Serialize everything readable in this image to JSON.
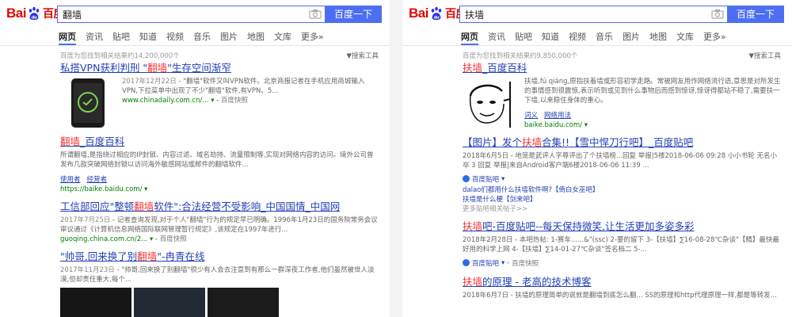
{
  "left": {
    "logo": {
      "text": "Bai",
      "zh": "百度"
    },
    "search": {
      "value": "翻墙",
      "button": "百度一下"
    },
    "tabs": [
      "网页",
      "资讯",
      "贴吧",
      "知道",
      "视频",
      "音乐",
      "图片",
      "地图",
      "文库",
      "更多»"
    ],
    "meta": {
      "count": "百度为您找到相关结果约14,200,000个",
      "tool": "搜索工具"
    },
    "results": [
      {
        "title_pre": "私搭VPN获利判刑 \"",
        "title_hl": "翻墙",
        "title_post": "\"生存空间渐窄",
        "date": "2017年12月22日",
        "abstract": " - \"翻墙\"软件又叫VPN软件。北京商报记者在手机应用商城输入VPN,下拉菜单中出现了不少\"翻墙\"软件,有VPN、5...",
        "url": "www.chinadaily.com.cn/...",
        "snap": "百度快照"
      },
      {
        "title_hl": "翻墙",
        "title_post": "_百度百科",
        "abstract": "所谓翻墙,是指绕过相应的IP封锁、内容过滤、域名劫持、流量限制等,实现对网络内容的访问。境外公司曾发布几款突破网络封锁以访问海外敏感网站或邮件的翻墙软件...",
        "subs": [
          "使用者",
          "经营者"
        ],
        "url": "https://baike.baidu.com/"
      },
      {
        "title_pre": "工信部回应\"整顿",
        "title_hl": "翻墙",
        "title_post": "软件\":合法经营不受影响_中国国情_中国网",
        "date": "2017年7月25日",
        "abstract": " - 记者查询发现,对于个人\"翻墙\"行为的规定早已明确。1996年1月23日的国务院常务会议审议通过《计算机信息网络国际联网管理暂行规定》,该规定在1997年进行...",
        "url": "guoqing.china.com.cn/2...",
        "snap": "百度快照"
      },
      {
        "title_pre": "\"帅哥,回来换了别",
        "title_hl": "翻墙",
        "title_post": "\"-冉青在线",
        "date": "2017年11月23日",
        "abstract": " - \"帅哥,回来换了别翻墙\"很少有人会去注意到有那么一群深夜工作者,他们虽然被世人淡漠,但却责任重大,每个..."
      }
    ]
  },
  "right": {
    "logo": {
      "text": "Bai",
      "zh": "百度"
    },
    "search": {
      "value": "扶墙",
      "button": "百度一下"
    },
    "tabs": [
      "网页",
      "资讯",
      "贴吧",
      "知道",
      "视频",
      "音乐",
      "图片",
      "地图",
      "文库",
      "更多»"
    ],
    "meta": {
      "count": "百度为您找到相关结果约9,850,000个",
      "tool": "搜索工具"
    },
    "results": [
      {
        "title_hl": "扶墙",
        "title_post": "_百度百科",
        "abstract": "扶墙,fú qiáng,原指扶着墙或形容初学走路。常被网友用作网络流行语,意思是对所发生的事情感到很震惊,表示听到或见到什么事物后而感到惊讶,惊讶得都站不稳了,需要扶一下墙,以来稳住身体的重心。",
        "subs": [
          "词义",
          "网络用法"
        ],
        "url": "baike.baidu.com/"
      },
      {
        "title_pre": "【图片】发个",
        "title_hl": "扶墙",
        "title_post": "合集!!【雪中悍刀行吧】_百度贴吧",
        "abstract": "2018年6月5日 - 地笼是武评人字尊评出了个扶墙榜...回复 举报|5楼2018-06-06 09:28 小小书轮 无名小卒 3 回复 举报|来自Android客户端6楼2018-06-06 11:39 ...",
        "tag": "百度贴吧",
        "sublinks": [
          "dalao们都用什么扶墙软件啊?【倚白女巫吧】",
          "扶墙是什么梗【剑来吧】"
        ],
        "more": "更多贴吧相关帖子>>"
      },
      {
        "title_hl": "扶墙",
        "title_post": "吧-百度贴吧--每天保持微笑,让生活更加多姿多彩",
        "abstract": "2018年2月28日 - 本吧热帖: 1-赛车......&\"(ssc) 2-要的留下 3-【扶墙】∑16-08-28℃杂谈\"【精】最快最好用的科学上网 4-【扶墙】∑14-01-27℃杂谈\"签名档二 5-...",
        "tag": "百度贴吧",
        "snap": "百度快照"
      },
      {
        "title_hl": "扶墙",
        "title_post": "的原理 - 老高的技术博客",
        "abstract": "2018年6月7日 - 扶墙的原理简单的说就是翻墙到底怎么翻... SS的原理和http代理原理一样,都是等转发..."
      }
    ]
  }
}
